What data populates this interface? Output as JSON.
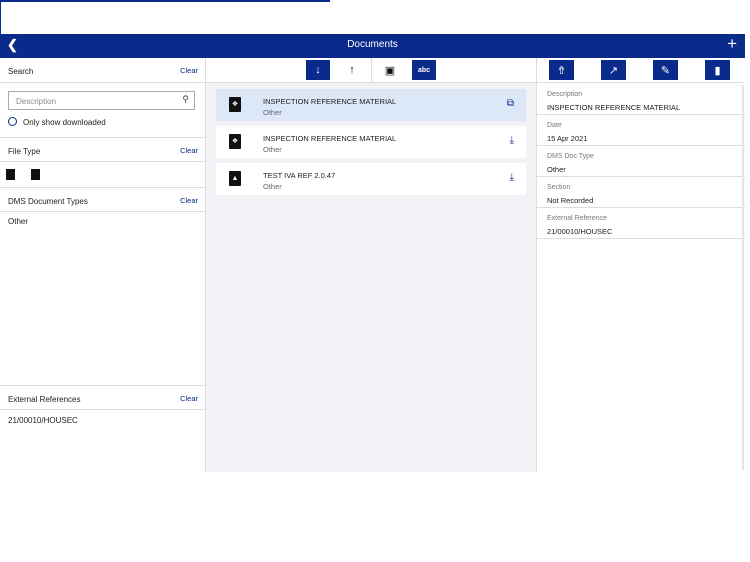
{
  "header": {
    "title": "Documents",
    "back_icon": "chevron-left",
    "add_icon": "plus"
  },
  "filters": {
    "search": {
      "label": "Search",
      "clear": "Clear",
      "placeholder": "Description",
      "only_downloaded": "Only show downloaded"
    },
    "file_type": {
      "label": "File Type",
      "clear": "Clear"
    },
    "dms": {
      "label": "DMS Document Types",
      "clear": "Clear",
      "items": [
        "Other"
      ]
    },
    "external": {
      "label": "External References",
      "clear": "Clear",
      "items": [
        "21/00010/HOUSEC"
      ]
    }
  },
  "toolbar": {
    "sort_desc": "↓",
    "sort_asc": "↑",
    "date": "▣",
    "abc": "abc"
  },
  "documents": [
    {
      "title": "INSPECTION REFERENCE MATERIAL",
      "type": "Other",
      "action": "open"
    },
    {
      "title": "INSPECTION REFERENCE MATERIAL",
      "type": "Other",
      "action": "download"
    },
    {
      "title": "TEST IVA REF 2.0.47",
      "type": "Other",
      "action": "download"
    }
  ],
  "details": [
    {
      "label": "Description",
      "value": "INSPECTION REFERENCE MATERIAL"
    },
    {
      "label": "Date",
      "value": "15 Apr 2021"
    },
    {
      "label": "DMS Doc Type",
      "value": "Other"
    },
    {
      "label": "Section",
      "value": "Not Recorded"
    },
    {
      "label": "External Reference",
      "value": "21/00010/HOUSEC"
    }
  ],
  "colors": {
    "primary": "#0a2a8c",
    "selected": "#dce8f7"
  }
}
